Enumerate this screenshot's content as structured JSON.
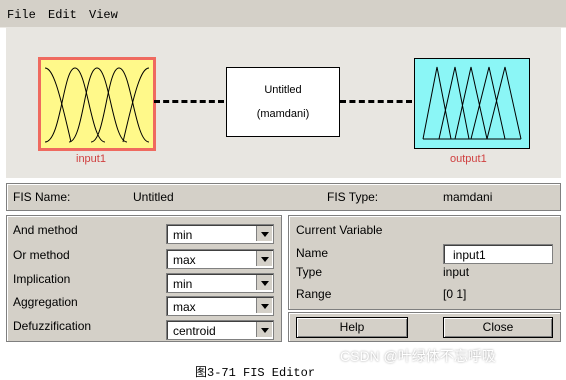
{
  "menu": {
    "items": [
      "File",
      "Edit",
      "View"
    ]
  },
  "diagram": {
    "input_label": "input1",
    "system_name": "Untitled",
    "system_type": "(mamdani)",
    "output_label": "output1"
  },
  "info": {
    "fis_name_label": "FIS Name:",
    "fis_name_value": "Untitled",
    "fis_type_label": "FIS Type:",
    "fis_type_value": "mamdani"
  },
  "methods": {
    "rows": [
      {
        "label": "And method",
        "value": "min"
      },
      {
        "label": "Or method",
        "value": "max"
      },
      {
        "label": "Implication",
        "value": "min"
      },
      {
        "label": "Aggregation",
        "value": "max"
      },
      {
        "label": "Defuzzification",
        "value": "centroid"
      }
    ]
  },
  "current_variable": {
    "title": "Current Variable",
    "name_label": "Name",
    "name_value": "input1",
    "type_label": "Type",
    "type_value": "input",
    "range_label": "Range",
    "range_value": "[0 1]"
  },
  "buttons": {
    "help": "Help",
    "close": "Close"
  },
  "caption": "图3-71  FIS  Editor",
  "watermark": "CSDN @叶绿体不忘呼吸",
  "colors": {
    "input_fill": "#fff98a",
    "input_border": "#ef6a5f",
    "output_fill": "#8bf6f6",
    "panel": "#d4d0c8"
  }
}
